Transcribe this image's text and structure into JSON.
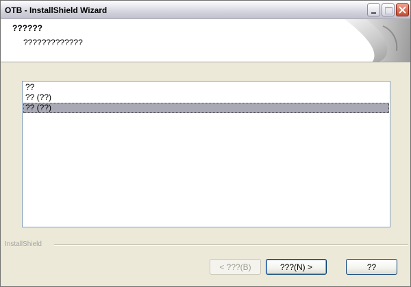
{
  "window": {
    "title": "OTB - InstallShield Wizard"
  },
  "header": {
    "title": "??????",
    "subtitle": "?????????????"
  },
  "list": {
    "items": [
      {
        "label": "??",
        "selected": false
      },
      {
        "label": "?? (??)",
        "selected": false
      },
      {
        "label": "?? (??)",
        "selected": true
      }
    ]
  },
  "footer": {
    "brand": "InstallShield"
  },
  "buttons": {
    "back": "< ???(B)",
    "next": "???(N) >",
    "cancel": "??"
  },
  "colors": {
    "selection": "#a9a9b6",
    "listbox_border": "#7f9db9",
    "button_border": "#003c74"
  },
  "icons": {
    "minimize": "minimize-icon",
    "maximize": "maximize-icon",
    "close": "close-icon",
    "banner": "page-curl-graphic"
  }
}
